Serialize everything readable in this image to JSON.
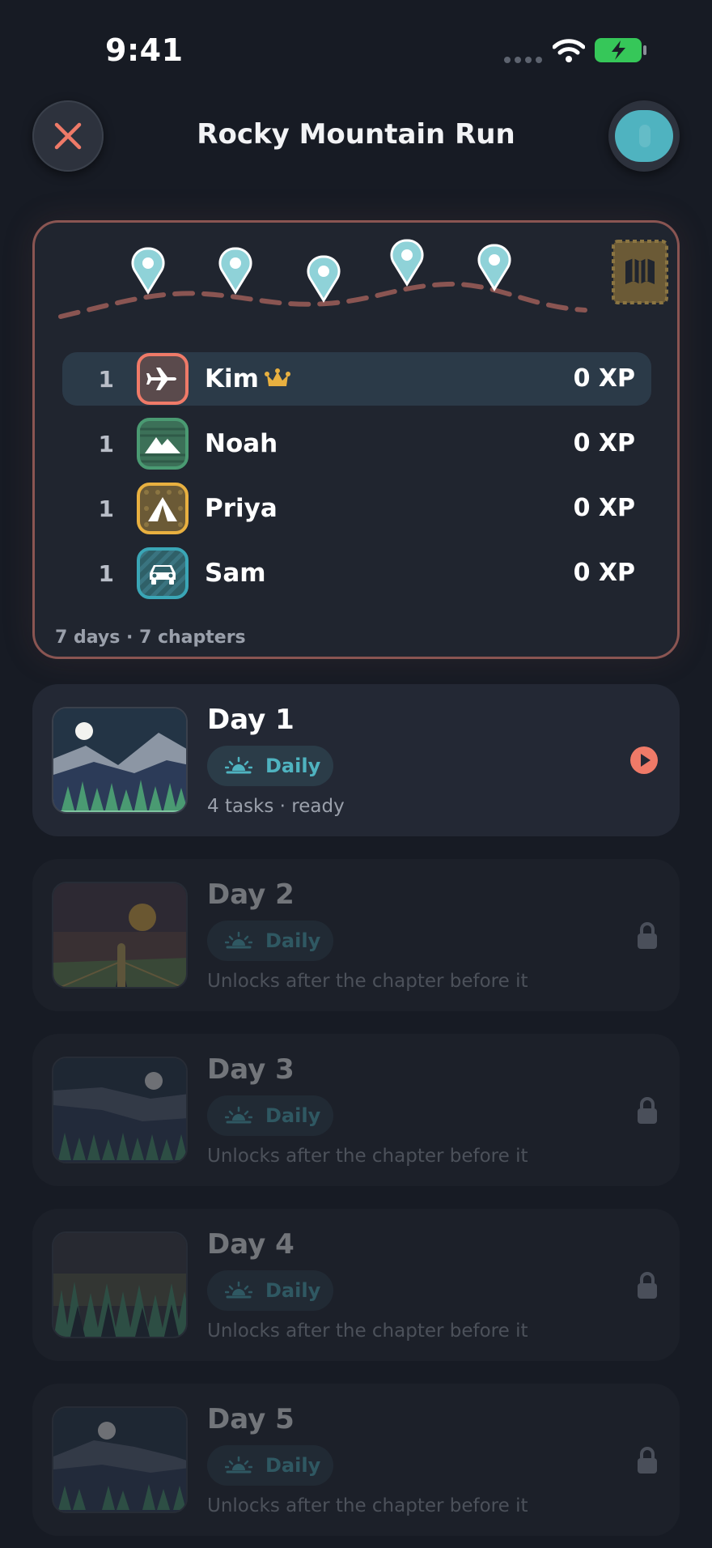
{
  "status_bar": {
    "time": "9:41"
  },
  "header": {
    "title": "Rocky Mountain Run"
  },
  "board": {
    "leaders": [
      {
        "rank": "1",
        "name": "Kim",
        "xp": "0 XP",
        "icon": "airplane-icon",
        "crown": true
      },
      {
        "rank": "1",
        "name": "Noah",
        "xp": "0 XP",
        "icon": "mountain-icon"
      },
      {
        "rank": "1",
        "name": "Priya",
        "xp": "0 XP",
        "icon": "tent-icon"
      },
      {
        "rank": "1",
        "name": "Sam",
        "xp": "0 XP",
        "icon": "car-icon"
      }
    ],
    "meta": "7 days · 7 chapters"
  },
  "days": [
    {
      "title": "Day 1",
      "tag": "Daily",
      "subtitle": "4 tasks · ready",
      "status": "ready"
    },
    {
      "title": "Day 2",
      "tag": "Daily",
      "subtitle": "Unlocks after the chapter before it",
      "status": "locked"
    },
    {
      "title": "Day 3",
      "tag": "Daily",
      "subtitle": "Unlocks after the chapter before it",
      "status": "locked"
    },
    {
      "title": "Day 4",
      "tag": "Daily",
      "subtitle": "Unlocks after the chapter before it",
      "status": "locked"
    },
    {
      "title": "Day 5",
      "tag": "Daily",
      "subtitle": "Unlocks after the chapter before it",
      "status": "locked"
    }
  ],
  "colors": {
    "background": "#171b24",
    "accent_teal": "#4fb3c0",
    "accent_coral": "#ef7a68",
    "board_border": "#8a5552",
    "kim": "#ef7a68",
    "noah": "#4a9a72",
    "priya": "#e8b040",
    "sam": "#3aa6b6"
  }
}
